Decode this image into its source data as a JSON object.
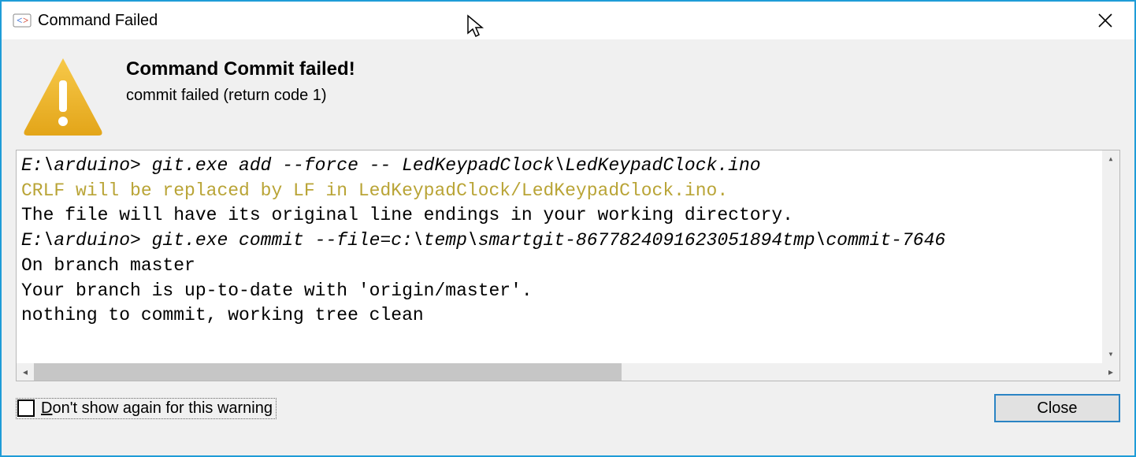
{
  "window": {
    "title": "Command Failed"
  },
  "header": {
    "title": "Command Commit failed!",
    "subtitle": "commit failed (return code 1)"
  },
  "console": {
    "lines": [
      {
        "text": "E:\\arduino> git.exe add --force -- LedKeypadClock\\LedKeypadClock.ino",
        "style": "italic"
      },
      {
        "text": "CRLF will be replaced by LF in LedKeypadClock/LedKeypadClock.ino.",
        "style": "warn"
      },
      {
        "text": "The file will have its original line endings in your working directory.",
        "style": ""
      },
      {
        "text": "E:\\arduino> git.exe commit --file=c:\\temp\\smartgit-8677824091623051894tmp\\commit-7646",
        "style": "italic"
      },
      {
        "text": "On branch master",
        "style": ""
      },
      {
        "text": "Your branch is up-to-date with 'origin/master'.",
        "style": ""
      },
      {
        "text": "nothing to commit, working tree clean",
        "style": ""
      }
    ]
  },
  "footer": {
    "checkbox_label_underline": "D",
    "checkbox_label_rest": "on't show again for this warning",
    "close_label": "Close"
  }
}
